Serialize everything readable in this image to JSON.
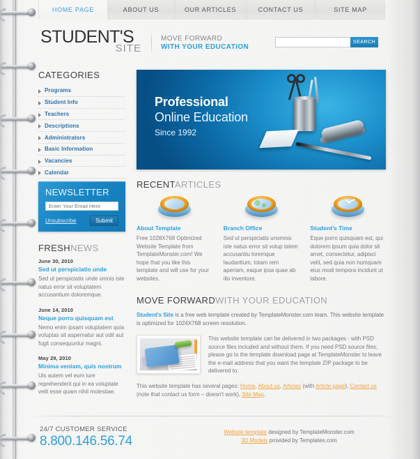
{
  "nav": {
    "items": [
      {
        "label": "Home page",
        "active": true
      },
      {
        "label": "About us",
        "active": false
      },
      {
        "label": "Our articles",
        "active": false
      },
      {
        "label": "Contact us",
        "active": false
      },
      {
        "label": "Site map",
        "active": false
      }
    ]
  },
  "header": {
    "logo_line1": "STUDENT'S",
    "logo_line2": "SITE",
    "tagline_line1": "MOVE FORWARD",
    "tagline_line2": "WITH YOUR EDUCATION",
    "search_value": "",
    "search_placeholder": "",
    "search_button": "Search"
  },
  "sidebar": {
    "categories_title": "CATEGORIES",
    "categories": [
      {
        "label": "Programs"
      },
      {
        "label": "Student Info"
      },
      {
        "label": "Teachers"
      },
      {
        "label": "Descriptions"
      },
      {
        "label": "Administrators"
      },
      {
        "label": "Basic Information"
      },
      {
        "label": "Vacancies"
      },
      {
        "label": "Calendar"
      }
    ],
    "newsletter": {
      "title": "NEWSLETTER",
      "input_value": "",
      "input_placeholder": "Enter Your Email Here",
      "unsubscribe": "Unsubscribe",
      "submit": "Submit"
    },
    "news_title_bold": "FRESH",
    "news_title_light": "NEWS",
    "news": [
      {
        "date": "June 30, 2010",
        "headline": "Sed ut perspiciatis unde",
        "body": "Sed ut perspiciatis unde omnis iste natus error sit voluptatem accusantium doloremque."
      },
      {
        "date": "June 14, 2010",
        "headline": "Neque porro quisquam est",
        "body": "Nemo enim ipsam voluptatem quia voluptas sit aspernatur aut odit aut fugit consequuntur magni."
      },
      {
        "date": "May 29, 2010",
        "headline": "Minima veniam, quis nostrum",
        "body": "Uis autem vel eum iure reprehenderit qui in ea voluptate velit esse quam nihil molestiae."
      }
    ]
  },
  "hero": {
    "line1": "Professional",
    "line2": "Online Education",
    "line3": "Since 1992"
  },
  "recent": {
    "title_bold": "RECENT",
    "title_light": "ARTICLES",
    "cards": [
      {
        "icon": "disc-arrow-icon",
        "title": "About Template",
        "body": "Free 1028X768 Optimized Website Template from TemplateMonster.com! We hope that you like this template and will use for your websites."
      },
      {
        "icon": "globe-icon",
        "title": "Branch Office",
        "body": "Sed ut perspiciatis unomnis iste natus error sit volup tatem accusantiu loremque laudantium, totam rem aperiam, eaque ipsa quae ab illo inventore."
      },
      {
        "icon": "clock-icon",
        "title": "Student's Time",
        "body": "Eque porro quisquam est, qui dolorem ipsum quia dolor sit amet, consectetur, adipisci velit, sed quia non numquam eius modi tempora incidunt ut labore."
      }
    ]
  },
  "move_forward": {
    "title_bold": "MOVE FORWARD",
    "title_light": "WITH YOUR EDUCATION",
    "lead_link": "Student's Site",
    "lead_rest": " is a free web template created by TemplateMonster.com team. This website template is optimized for 1024X768 screen resolution.",
    "image": "binder-and-papers-photo",
    "body": "This website template can be delivered in two packages - with PSD source files included and without them. If you need PSD source files, please go to the template download page at TemplateMonster to leave the e-mail address that you want the template ZIP package to be delivered to.",
    "footer_prefix": "This website template has several pages: ",
    "footer_links": [
      "Home",
      "About us",
      "Articles",
      "Article page",
      "Contact us",
      "Site Map"
    ],
    "footer_mid1": ", ",
    "footer_mid2": ", ",
    "footer_mid3": " (with ",
    "footer_mid4": "), ",
    "footer_mid5": " (note that contact us form – doesn't work), ",
    "footer_end": "."
  },
  "footer": {
    "service_label": "24/7 CUSTOMER SERVICE",
    "phone": "8.800.146.56.74",
    "credit1_link": "Website template",
    "credit1_rest": " designed by TemplateMonster.com",
    "credit2_link": "3D Models",
    "credit2_rest": " provided by Templates.com"
  },
  "colors": {
    "accent_blue": "#2e9fdc",
    "link_orange": "#f0a040",
    "category_blue": "#2e71a8",
    "text_gray": "#76797c"
  }
}
